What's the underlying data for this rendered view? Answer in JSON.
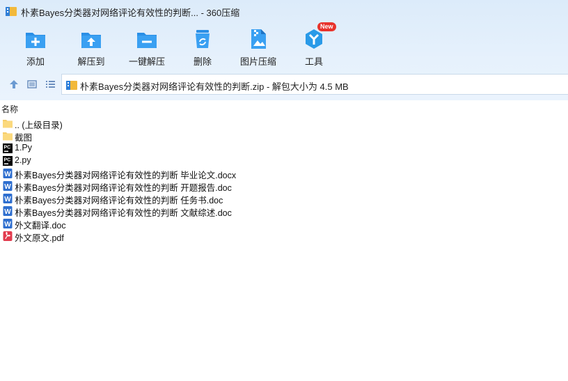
{
  "window": {
    "title": "朴素Bayes分类器对网络评论有效性的判断... - 360压缩"
  },
  "toolbar": {
    "add": "添加",
    "extract_to": "解压到",
    "one_click_extract": "一键解压",
    "delete": "删除",
    "image_compress": "图片压缩",
    "tools": "工具",
    "tools_badge": "New"
  },
  "address": {
    "text": "朴素Bayes分类器对网络评论有效性的判断.zip - 解包大小为 4.5 MB"
  },
  "columns": {
    "name": "名称"
  },
  "files": [
    {
      "name": ".. (上级目录)",
      "icon": "folder-icon"
    },
    {
      "name": "截图",
      "icon": "folder-icon"
    },
    {
      "name": "1.Py",
      "icon": "pycharm-file-icon"
    },
    {
      "name": "2.py",
      "icon": "pycharm-file-icon"
    },
    {
      "name": "朴素Bayes分类器对网络评论有效性的判断 毕业论文.docx",
      "icon": "word-doc-icon"
    },
    {
      "name": "朴素Bayes分类器对网络评论有效性的判断 开题报告.doc",
      "icon": "word-doc-icon"
    },
    {
      "name": "朴素Bayes分类器对网络评论有效性的判断 任务书.doc",
      "icon": "word-doc-icon"
    },
    {
      "name": "朴素Bayes分类器对网络评论有效性的判断 文献综述.doc",
      "icon": "word-doc-icon"
    },
    {
      "name": "外文翻译.doc",
      "icon": "word-doc-icon"
    },
    {
      "name": "外文原文.pdf",
      "icon": "pdf-icon"
    }
  ]
}
